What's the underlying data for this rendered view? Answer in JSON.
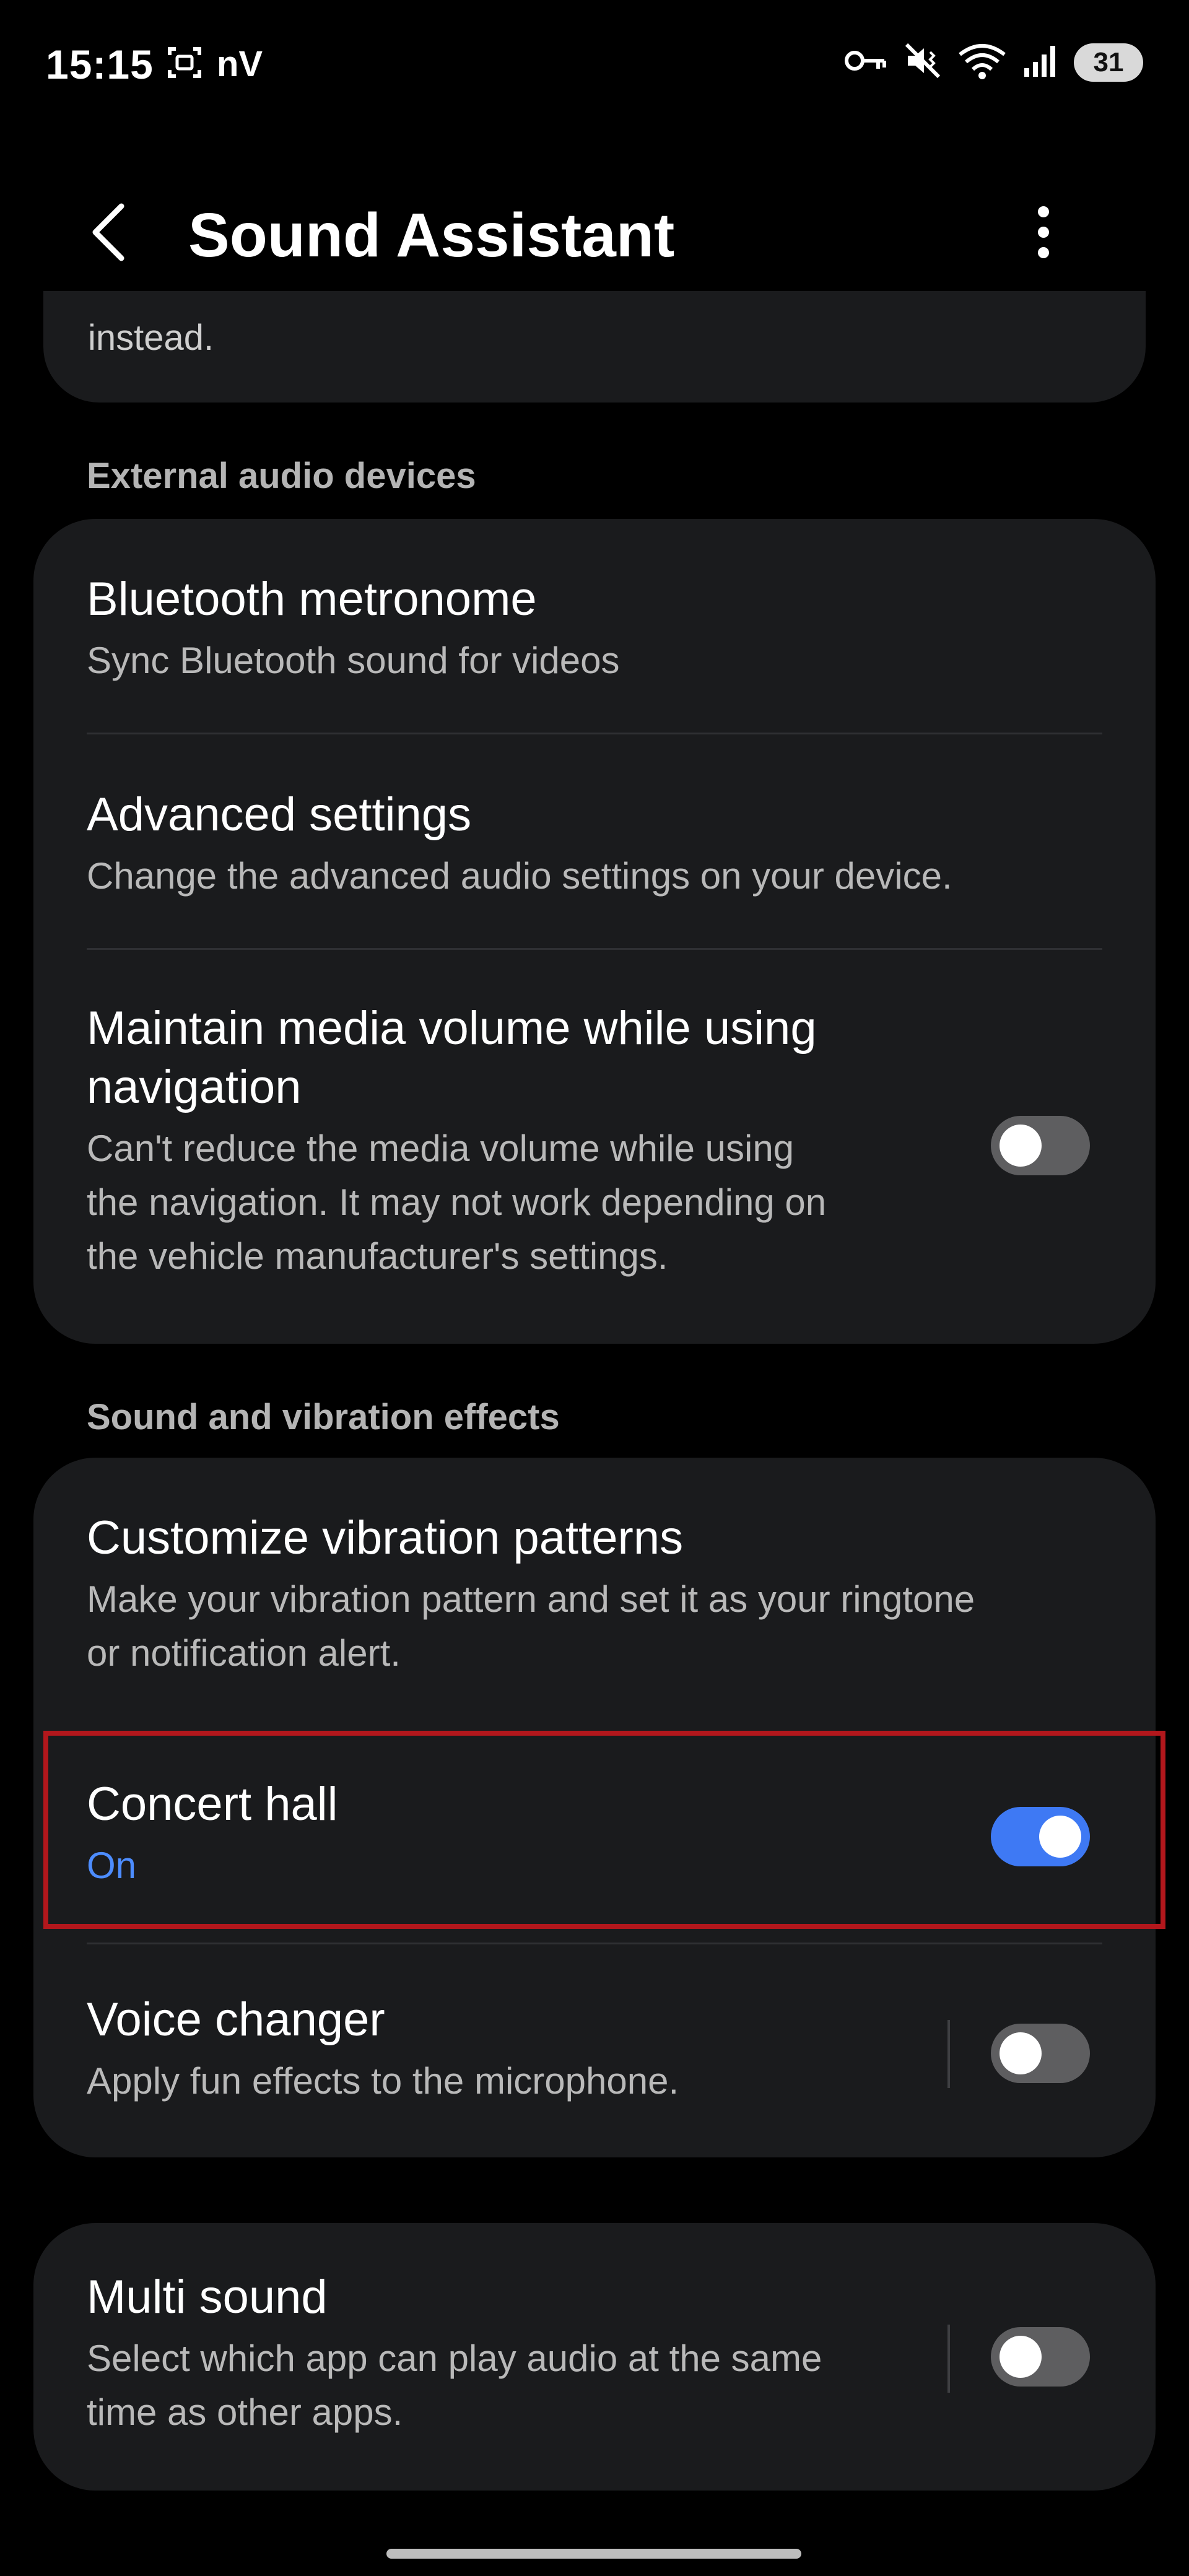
{
  "status_bar": {
    "time": "15:15",
    "left_icons": [
      "screen-capture-icon",
      "nv-icon"
    ],
    "left_text": "nV",
    "right_icons": [
      "vpn-key-icon",
      "mute-vibrate-icon",
      "wifi-icon",
      "signal-icon"
    ],
    "battery": "31"
  },
  "app_bar": {
    "title": "Sound Assistant",
    "back_icon": "back-arrow-icon",
    "more_icon": "more-vertical-icon"
  },
  "partial_card": {
    "text": "instead."
  },
  "sections": {
    "external_audio": {
      "header": "External audio devices",
      "items": [
        {
          "title": "Bluetooth metronome",
          "subtitle": "Sync Bluetooth sound for videos"
        },
        {
          "title": "Advanced settings",
          "subtitle": "Change the advanced audio settings on your device."
        },
        {
          "title_line1": "Maintain media volume while using",
          "title_line2": "navigation",
          "sub_line1": "Can't reduce the media volume while using",
          "sub_line2": "the navigation. It may not work depending on",
          "sub_line3": "the vehicle manufacturer's settings.",
          "toggle": "off"
        }
      ]
    },
    "sound_vibration": {
      "header": "Sound and vibration effects",
      "items": [
        {
          "title": "Customize vibration patterns",
          "sub_line1": "Make your vibration pattern and set it as your ringtone",
          "sub_line2": "or notification alert."
        },
        {
          "title": "Concert hall",
          "subtitle": "On",
          "toggle": "on"
        },
        {
          "title": "Voice changer",
          "subtitle": "Apply fun effects to the microphone.",
          "toggle": "off"
        }
      ]
    },
    "multi": {
      "items": [
        {
          "title": "Multi sound",
          "sub_line1": "Select which app can play audio at the same",
          "sub_line2": "time as other apps.",
          "toggle": "off"
        }
      ]
    }
  },
  "colors": {
    "background": "#000000",
    "card": "#1a1b1d",
    "accent": "#3e79f4",
    "on_text": "#4d8dff",
    "highlight": "#b2171c"
  }
}
